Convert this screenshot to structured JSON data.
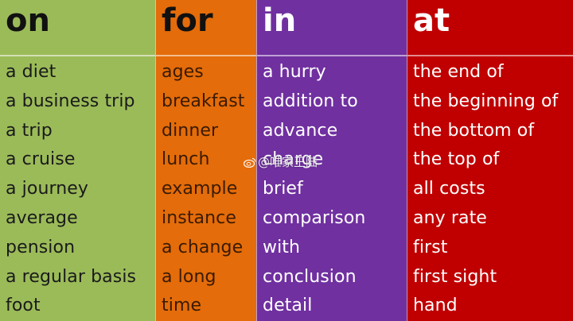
{
  "columns": [
    {
      "header": "on",
      "color": "#9bbb59",
      "items": [
        "a diet",
        "a business trip",
        "a trip",
        "a cruise",
        "a journey",
        "average",
        "pension",
        "a regular basis",
        "foot"
      ]
    },
    {
      "header": "for",
      "color": "#e46c0a",
      "items": [
        "ages",
        "breakfast",
        "dinner",
        "lunch",
        "example",
        "instance",
        "a change",
        "a long",
        "time"
      ]
    },
    {
      "header": "in",
      "color": "#7030a0",
      "items": [
        "a hurry",
        "addition to",
        "advance",
        "charge",
        "brief",
        "comparison",
        "with",
        "conclusion",
        "detail"
      ]
    },
    {
      "header": "at",
      "color": "#c00000",
      "items": [
        "the end of",
        "the beginning of",
        "the bottom of",
        "the top of",
        "all costs",
        "any rate",
        "first",
        "first sight",
        "hand"
      ]
    }
  ],
  "watermark": {
    "icon": "weibo-icon",
    "text": "@唯家王陆"
  }
}
